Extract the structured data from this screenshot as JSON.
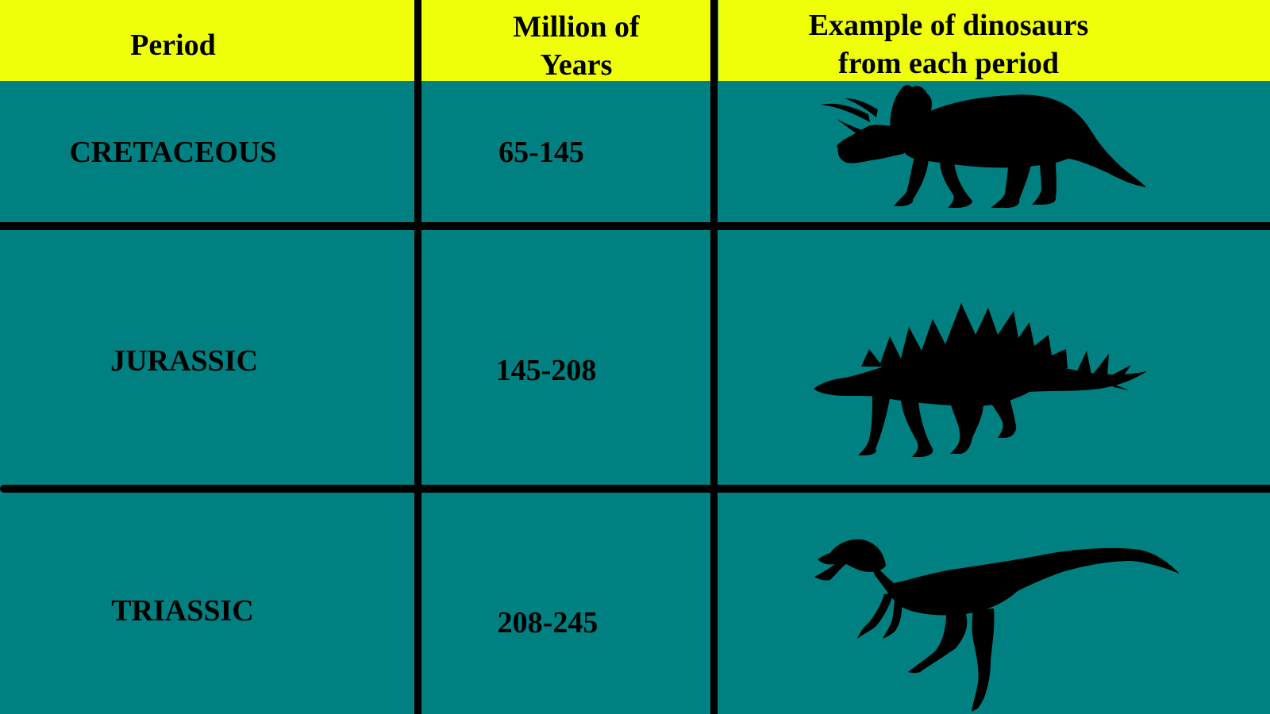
{
  "table": {
    "headers": {
      "period": "Period",
      "million_line1": "Million of",
      "million_line2": "Years",
      "example_line1": "Example of dinosaurs",
      "example_line2": "from each period"
    },
    "rows": [
      {
        "period": "CRETACEOUS",
        "years": "65-145",
        "dinosaur_icon": "triceratops-silhouette-icon"
      },
      {
        "period": "JURASSIC",
        "years": "145-208",
        "dinosaur_icon": "stegosaurus-silhouette-icon"
      },
      {
        "period": "TRIASSIC",
        "years": "208-245",
        "dinosaur_icon": "theropod-silhouette-icon"
      }
    ]
  },
  "colors": {
    "header_background": "#EEFF09",
    "body_background": "#008080",
    "grid_lines": "#000000",
    "silhouettes": "#000000"
  }
}
